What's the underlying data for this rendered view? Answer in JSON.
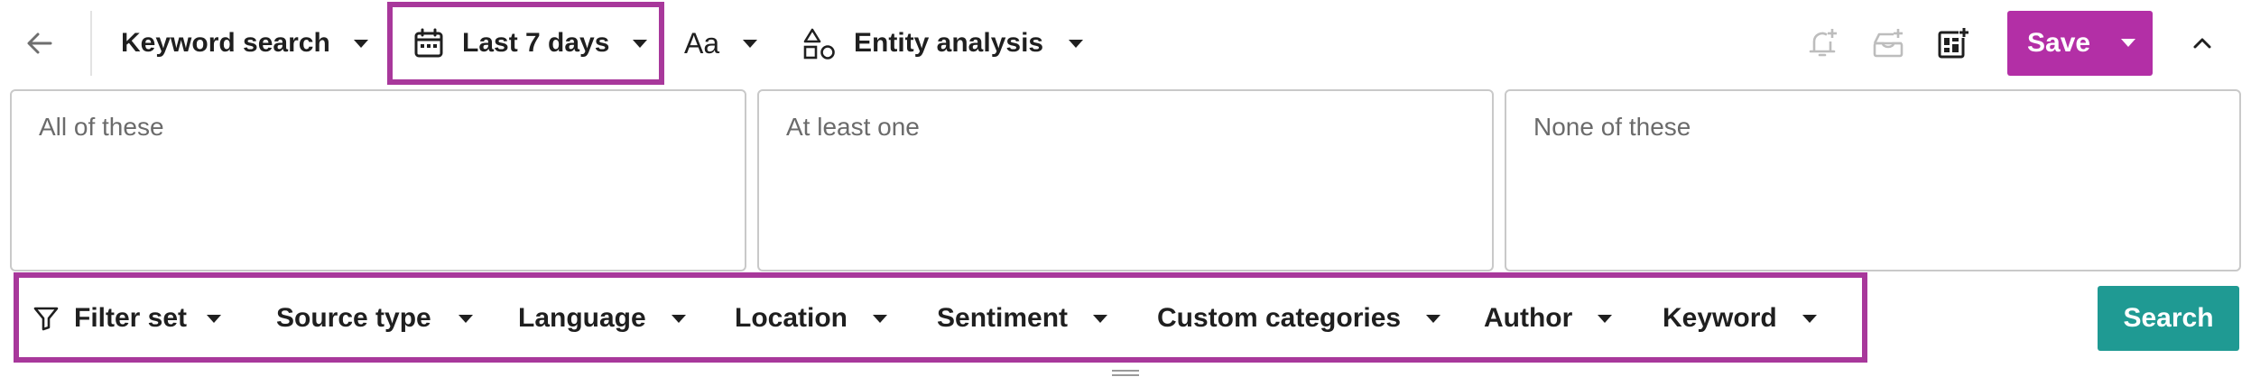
{
  "toolbar": {
    "back_icon": "arrow-left-icon",
    "search_mode": "Keyword search",
    "date_range": "Last 7 days",
    "text_format": "Aa",
    "analysis": "Entity analysis",
    "alert_icon": "add-alert-icon",
    "newsletter_icon": "add-newsletter-icon",
    "dashboard_icon": "add-dashboard-icon",
    "save_label": "Save",
    "collapse_icon": "chevron-up-icon"
  },
  "keyword_boxes": {
    "all": "All of these",
    "any": "At least one",
    "none": "None of these"
  },
  "filters": [
    {
      "label": "Filter set",
      "icon": "funnel-icon"
    },
    {
      "label": "Source type"
    },
    {
      "label": "Language"
    },
    {
      "label": "Location"
    },
    {
      "label": "Sentiment"
    },
    {
      "label": "Custom categories"
    },
    {
      "label": "Author"
    },
    {
      "label": "Keyword"
    }
  ],
  "search_label": "Search",
  "colors": {
    "accent": "#b32fa6",
    "highlight": "#a8389b",
    "search": "#1f9a93"
  }
}
